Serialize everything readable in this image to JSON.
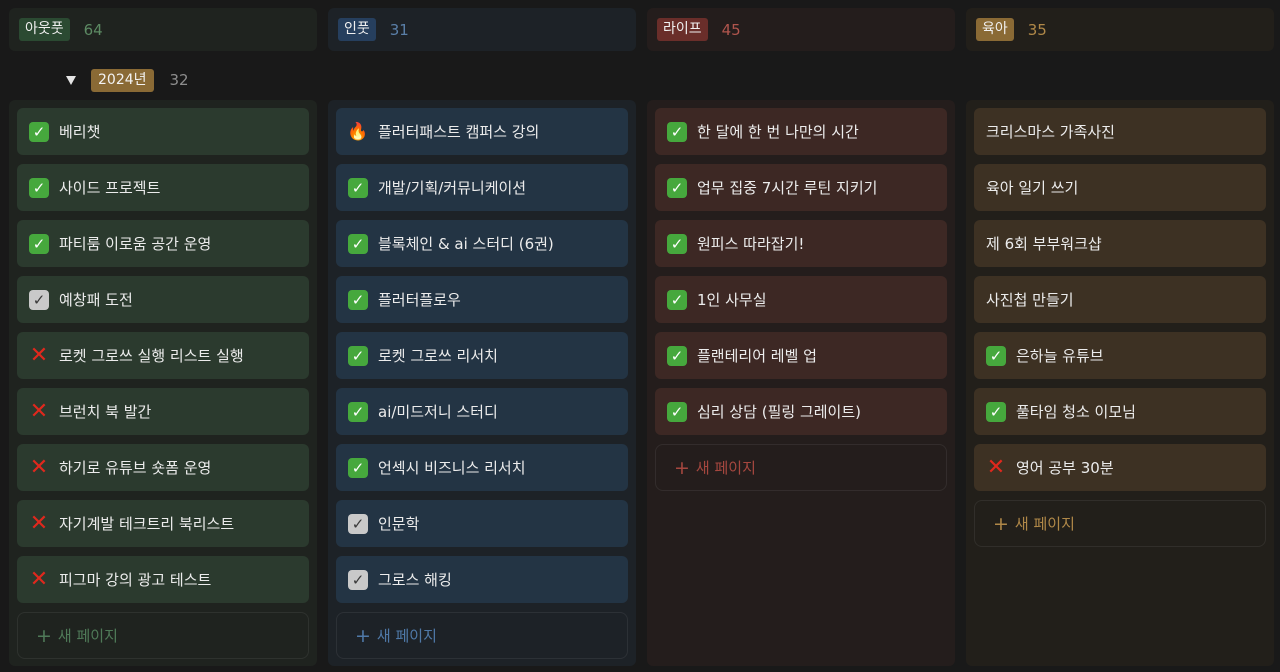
{
  "colors": {
    "outfit": "#2b3e2f",
    "infit": "#263a52",
    "life": "#5a2b27",
    "parenting": "#8a6a35"
  },
  "new_page_label": "새 페이지",
  "group": {
    "label": "2024년",
    "count": "32"
  },
  "columns": [
    {
      "tag": "아웃풋",
      "count": "64",
      "cards": [
        {
          "icon": "check",
          "text": "베리챗"
        },
        {
          "icon": "check",
          "text": "사이드 프로젝트"
        },
        {
          "icon": "check",
          "text": "파티룸 이로움 공간 운영"
        },
        {
          "icon": "grey",
          "text": "예창패 도전"
        },
        {
          "icon": "cross",
          "text": "로켓 그로쓰 실행 리스트 실행"
        },
        {
          "icon": "cross",
          "text": "브런치 북 발간"
        },
        {
          "icon": "cross",
          "text": "하기로 유튜브 숏폼 운영"
        },
        {
          "icon": "cross",
          "text": "자기계발 테크트리 북리스트"
        },
        {
          "icon": "cross",
          "text": "피그마 강의 광고 테스트"
        }
      ]
    },
    {
      "tag": "인풋",
      "count": "31",
      "cards": [
        {
          "icon": "fire",
          "text": "플러터패스트 캠퍼스 강의"
        },
        {
          "icon": "check",
          "text": "개발/기획/커뮤니케이션"
        },
        {
          "icon": "check",
          "text": "블록체인 & ai 스터디 (6권)"
        },
        {
          "icon": "check",
          "text": "플러터플로우"
        },
        {
          "icon": "check",
          "text": "로켓 그로쓰 리서치"
        },
        {
          "icon": "check",
          "text": "ai/미드저니 스터디"
        },
        {
          "icon": "check",
          "text": "언섹시 비즈니스 리서치"
        },
        {
          "icon": "grey",
          "text": "인문학"
        },
        {
          "icon": "grey",
          "text": "그로스 해킹"
        }
      ]
    },
    {
      "tag": "라이프",
      "count": "45",
      "cards": [
        {
          "icon": "check",
          "text": "한 달에 한 번 나만의 시간"
        },
        {
          "icon": "check",
          "text": "업무 집중 7시간 루틴 지키기"
        },
        {
          "icon": "check",
          "text": "원피스 따라잡기!"
        },
        {
          "icon": "check",
          "text": "1인 사무실"
        },
        {
          "icon": "check",
          "text": "플랜테리어 레벨 업"
        },
        {
          "icon": "check",
          "text": "심리 상담 (필링 그레이트)"
        }
      ]
    },
    {
      "tag": "육아",
      "count": "35",
      "cards": [
        {
          "icon": "none",
          "text": "크리스마스 가족사진"
        },
        {
          "icon": "none",
          "text": "육아 일기 쓰기"
        },
        {
          "icon": "none",
          "text": "제 6회 부부워크샵"
        },
        {
          "icon": "none",
          "text": "사진첩 만들기"
        },
        {
          "icon": "check",
          "text": "은하늘 유튜브"
        },
        {
          "icon": "check",
          "text": "풀타임 청소 이모님"
        },
        {
          "icon": "cross",
          "text": "영어 공부 30분"
        }
      ]
    }
  ]
}
